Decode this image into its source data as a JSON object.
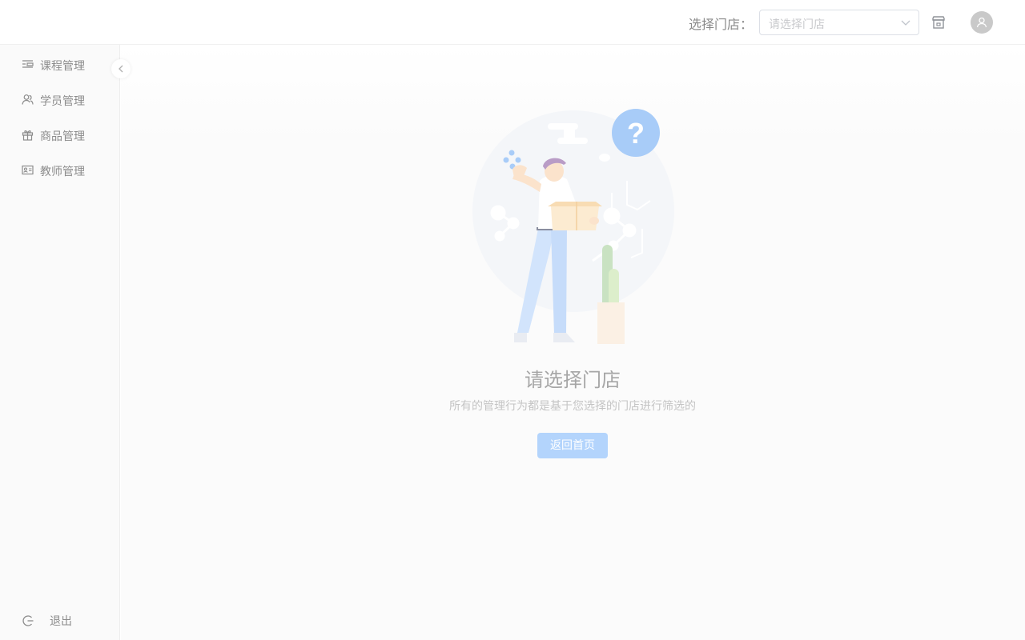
{
  "header": {
    "store_label": "选择门店：",
    "store_select": {
      "placeholder": "请选择门店",
      "value": ""
    },
    "icons": {
      "dropdown": "chevron-down-icon",
      "store": "shop-icon",
      "user": "user-avatar-icon"
    }
  },
  "sidebar": {
    "items": [
      {
        "label": "课程管理",
        "icon": "course-list-icon"
      },
      {
        "label": "学员管理",
        "icon": "students-icon"
      },
      {
        "label": "商品管理",
        "icon": "gift-icon"
      },
      {
        "label": "教师管理",
        "icon": "id-card-icon"
      }
    ],
    "logout": {
      "label": "退出",
      "icon": "logout-icon"
    },
    "collapse_icon": "chevron-left-icon"
  },
  "main": {
    "empty_state": {
      "title": "请选择门店",
      "description": "所有的管理行为都是基于您选择的门店进行筛选的",
      "button_label": "返回首页",
      "illustration": "person-holding-box-question-illustration",
      "question_mark": "?"
    }
  },
  "colors": {
    "accent": "#b3d4fc",
    "sidebar_bg": "#fafafa",
    "text_muted": "#8c8c8c"
  }
}
